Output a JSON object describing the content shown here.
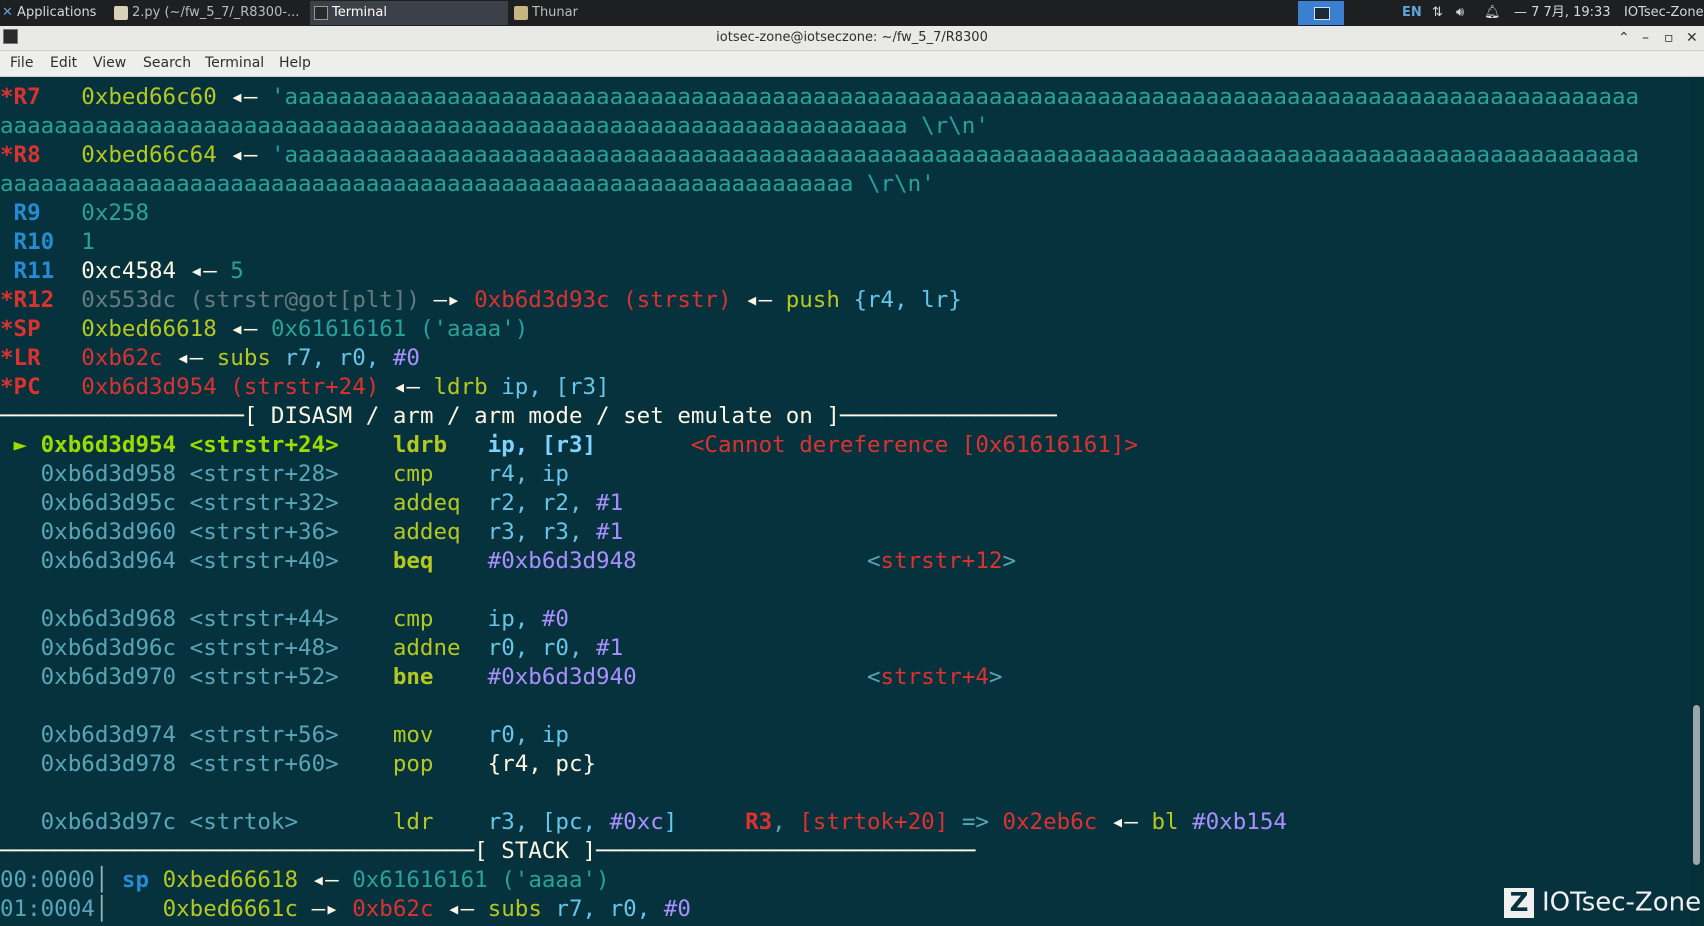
{
  "panel": {
    "apps_label": "Applications",
    "tasks": [
      {
        "label": "2.py (~/fw_5_7/_R8300-...",
        "icon": "text-editor-icon"
      },
      {
        "label": "Terminal",
        "icon": "terminal-icon"
      },
      {
        "label": "Thunar",
        "icon": "folder-icon"
      }
    ],
    "lang": "EN",
    "datetime": "— 7 7月, 19:33",
    "user": "IOTsec-Zone"
  },
  "window": {
    "title": "iotsec-zone@iotseczone: ~/fw_5_7/R8300"
  },
  "menu": [
    "File",
    "Edit",
    "View",
    "Search",
    "Terminal",
    "Help"
  ],
  "terminal": {
    "lines": [
      [
        {
          "t": "*R7",
          "c": "c-redb"
        },
        {
          "t": "   "
        },
        {
          "t": "0xbed66c60",
          "c": "c-yellow"
        },
        {
          "t": " ◂— ",
          "c": "c-white"
        },
        {
          "t": "'aaaaaaaaaaaaaaaaaaaaaaaaaaaaaaaaaaaaaaaaaaaaaaaaaaaaaaaaaaaaaaaaaaaaaaaaaaaaaaaaaaaaaaaaaaaaaaaaaaaa",
          "c": "c-cyan"
        }
      ],
      [
        {
          "t": "aaaaaaaaaaaaaaaaaaaaaaaaaaaaaaaaaaaaaaaaaaaaaaaaaaaaaaaaaaaaaaaaaaa \\r\\n'",
          "c": "c-cyan"
        }
      ],
      [
        {
          "t": "*R8",
          "c": "c-redb"
        },
        {
          "t": "   "
        },
        {
          "t": "0xbed66c64",
          "c": "c-yellow"
        },
        {
          "t": " ◂— ",
          "c": "c-white"
        },
        {
          "t": "'aaaaaaaaaaaaaaaaaaaaaaaaaaaaaaaaaaaaaaaaaaaaaaaaaaaaaaaaaaaaaaaaaaaaaaaaaaaaaaaaaaaaaaaaaaaaaaaaaaaa",
          "c": "c-cyan"
        }
      ],
      [
        {
          "t": "aaaaaaaaaaaaaaaaaaaaaaaaaaaaaaaaaaaaaaaaaaaaaaaaaaaaaaaaaaaaaaa \\r\\n'",
          "c": "c-cyan"
        }
      ],
      [
        {
          "t": " R9",
          "c": "c-cyanb"
        },
        {
          "t": "   "
        },
        {
          "t": "0x258",
          "c": "c-cyan"
        }
      ],
      [
        {
          "t": " R10",
          "c": "c-cyanb"
        },
        {
          "t": "  "
        },
        {
          "t": "1",
          "c": "c-cyan"
        }
      ],
      [
        {
          "t": " R11",
          "c": "c-cyanb"
        },
        {
          "t": "  "
        },
        {
          "t": "0xc4584",
          "c": "c-white"
        },
        {
          "t": " ◂— ",
          "c": "c-white"
        },
        {
          "t": "5",
          "c": "c-cyan"
        }
      ],
      [
        {
          "t": "*R12",
          "c": "c-redb"
        },
        {
          "t": "  "
        },
        {
          "t": "0x553dc (strstr@got[plt])",
          "c": "c-gray"
        },
        {
          "t": " —▸ ",
          "c": "c-white"
        },
        {
          "t": "0xb6d3d93c (strstr)",
          "c": "c-red"
        },
        {
          "t": " ◂— ",
          "c": "c-white"
        },
        {
          "t": "push ",
          "c": "c-yellow"
        },
        {
          "t": "{r4, lr}",
          "c": "c-blue"
        }
      ],
      [
        {
          "t": "*SP",
          "c": "c-redb"
        },
        {
          "t": "   "
        },
        {
          "t": "0xbed66618",
          "c": "c-yellow"
        },
        {
          "t": " ◂— ",
          "c": "c-white"
        },
        {
          "t": "0x61616161 ('aaaa')",
          "c": "c-cyan"
        }
      ],
      [
        {
          "t": "*LR",
          "c": "c-redb"
        },
        {
          "t": "   "
        },
        {
          "t": "0xb62c",
          "c": "c-red"
        },
        {
          "t": " ◂— ",
          "c": "c-white"
        },
        {
          "t": "subs ",
          "c": "c-yellow"
        },
        {
          "t": "r7, r0, ",
          "c": "c-blue"
        },
        {
          "t": "#0",
          "c": "c-violet"
        }
      ],
      [
        {
          "t": "*PC",
          "c": "c-redb"
        },
        {
          "t": "   "
        },
        {
          "t": "0xb6d3d954 (strstr+24)",
          "c": "c-red"
        },
        {
          "t": " ◂— ",
          "c": "c-white"
        },
        {
          "t": "ldrb ",
          "c": "c-yellow"
        },
        {
          "t": "ip, [r3]",
          "c": "c-blue"
        }
      ],
      [
        {
          "t": "──────────────────",
          "c": "c-white"
        },
        {
          "t": "[ DISASM / arm / arm mode / set emulate on ]",
          "c": "c-white"
        },
        {
          "t": "────────────────",
          "c": "c-white"
        }
      ],
      [
        {
          "t": " ► ",
          "c": "c-greenb"
        },
        {
          "t": "0xb6d3d954 <strstr+24>",
          "c": "c-greenb"
        },
        {
          "t": "    "
        },
        {
          "t": "ldrb",
          "c": "c-yellowb"
        },
        {
          "t": "   "
        },
        {
          "t": "ip, [r3]",
          "c": "c-blueb"
        },
        {
          "t": "       "
        },
        {
          "t": "<Cannot dereference [0x61616161]>",
          "c": "c-red"
        }
      ],
      [
        {
          "t": "   "
        },
        {
          "t": "0xb6d3d958 <strstr+28>",
          "c": "c-pale"
        },
        {
          "t": "    "
        },
        {
          "t": "cmp",
          "c": "c-yellow"
        },
        {
          "t": "    "
        },
        {
          "t": "r4, ip",
          "c": "c-blue"
        }
      ],
      [
        {
          "t": "   "
        },
        {
          "t": "0xb6d3d95c <strstr+32>",
          "c": "c-pale"
        },
        {
          "t": "    "
        },
        {
          "t": "addeq",
          "c": "c-yellow"
        },
        {
          "t": "  "
        },
        {
          "t": "r2, r2, ",
          "c": "c-blue"
        },
        {
          "t": "#1",
          "c": "c-violet"
        }
      ],
      [
        {
          "t": "   "
        },
        {
          "t": "0xb6d3d960 <strstr+36>",
          "c": "c-pale"
        },
        {
          "t": "    "
        },
        {
          "t": "addeq",
          "c": "c-yellow"
        },
        {
          "t": "  "
        },
        {
          "t": "r3, r3, ",
          "c": "c-blue"
        },
        {
          "t": "#1",
          "c": "c-violet"
        }
      ],
      [
        {
          "t": "   "
        },
        {
          "t": "0xb6d3d964 <strstr+40>",
          "c": "c-pale"
        },
        {
          "t": "    "
        },
        {
          "t": "beq",
          "c": "c-yellowb"
        },
        {
          "t": "    "
        },
        {
          "t": "#0xb6d3d948",
          "c": "c-violet"
        },
        {
          "t": "                 "
        },
        {
          "t": "<",
          "c": "c-pale"
        },
        {
          "t": "strstr+12",
          "c": "c-red"
        },
        {
          "t": ">",
          "c": "c-pale"
        }
      ],
      [],
      [
        {
          "t": "   "
        },
        {
          "t": "0xb6d3d968 <strstr+44>",
          "c": "c-pale"
        },
        {
          "t": "    "
        },
        {
          "t": "cmp",
          "c": "c-yellow"
        },
        {
          "t": "    "
        },
        {
          "t": "ip, ",
          "c": "c-blue"
        },
        {
          "t": "#0",
          "c": "c-violet"
        }
      ],
      [
        {
          "t": "   "
        },
        {
          "t": "0xb6d3d96c <strstr+48>",
          "c": "c-pale"
        },
        {
          "t": "    "
        },
        {
          "t": "addne",
          "c": "c-yellow"
        },
        {
          "t": "  "
        },
        {
          "t": "r0, r0, ",
          "c": "c-blue"
        },
        {
          "t": "#1",
          "c": "c-violet"
        }
      ],
      [
        {
          "t": "   "
        },
        {
          "t": "0xb6d3d970 <strstr+52>",
          "c": "c-pale"
        },
        {
          "t": "    "
        },
        {
          "t": "bne",
          "c": "c-yellowb"
        },
        {
          "t": "    "
        },
        {
          "t": "#0xb6d3d940",
          "c": "c-violet"
        },
        {
          "t": "                 "
        },
        {
          "t": "<",
          "c": "c-pale"
        },
        {
          "t": "strstr+4",
          "c": "c-red"
        },
        {
          "t": ">",
          "c": "c-pale"
        }
      ],
      [],
      [
        {
          "t": "   "
        },
        {
          "t": "0xb6d3d974 <strstr+56>",
          "c": "c-pale"
        },
        {
          "t": "    "
        },
        {
          "t": "mov",
          "c": "c-yellow"
        },
        {
          "t": "    "
        },
        {
          "t": "r0, ip",
          "c": "c-blue"
        }
      ],
      [
        {
          "t": "   "
        },
        {
          "t": "0xb6d3d978 <strstr+60>",
          "c": "c-pale"
        },
        {
          "t": "    "
        },
        {
          "t": "pop",
          "c": "c-yellow"
        },
        {
          "t": "    "
        },
        {
          "t": "{r4, pc}",
          "c": "c-white"
        }
      ],
      [],
      [
        {
          "t": "   "
        },
        {
          "t": "0xb6d3d97c <strtok>",
          "c": "c-pale"
        },
        {
          "t": "       "
        },
        {
          "t": "ldr",
          "c": "c-yellow"
        },
        {
          "t": "    "
        },
        {
          "t": "r3, [pc, ",
          "c": "c-blue"
        },
        {
          "t": "#0xc",
          "c": "c-violet"
        },
        {
          "t": "]",
          "c": "c-blue"
        },
        {
          "t": "     "
        },
        {
          "t": "R3",
          "c": "c-redb"
        },
        {
          "t": ", ",
          "c": "c-pale"
        },
        {
          "t": "[strtok+20]",
          "c": "c-red"
        },
        {
          "t": " => ",
          "c": "c-pale"
        },
        {
          "t": "0x2eb6c",
          "c": "c-red"
        },
        {
          "t": " ◂— ",
          "c": "c-white"
        },
        {
          "t": "bl ",
          "c": "c-yellow"
        },
        {
          "t": "#0xb154",
          "c": "c-violet"
        }
      ],
      [
        {
          "t": "───────────────────────────────────",
          "c": "c-white"
        },
        {
          "t": "[ STACK ]",
          "c": "c-white"
        },
        {
          "t": "────────────────────────────",
          "c": "c-white"
        }
      ],
      [
        {
          "t": "00:0000",
          "c": "c-pale"
        },
        {
          "t": "│ ",
          "c": "c-bar"
        },
        {
          "t": "sp ",
          "c": "c-cyanb"
        },
        {
          "t": "0xbed66618",
          "c": "c-yellow"
        },
        {
          "t": " ◂— ",
          "c": "c-white"
        },
        {
          "t": "0x61616161 ('aaaa')",
          "c": "c-cyan"
        }
      ],
      [
        {
          "t": "01:0004",
          "c": "c-pale"
        },
        {
          "t": "│    ",
          "c": "c-bar"
        },
        {
          "t": "0xbed6661c",
          "c": "c-yellow"
        },
        {
          "t": " —▸ ",
          "c": "c-white"
        },
        {
          "t": "0xb62c",
          "c": "c-red"
        },
        {
          "t": " ◂— ",
          "c": "c-white"
        },
        {
          "t": "subs ",
          "c": "c-yellow"
        },
        {
          "t": "r7, r0, ",
          "c": "c-blue"
        },
        {
          "t": "#0",
          "c": "c-violet"
        }
      ]
    ]
  },
  "watermark": {
    "logo": "Z",
    "text": "IOTsec-Zone"
  }
}
